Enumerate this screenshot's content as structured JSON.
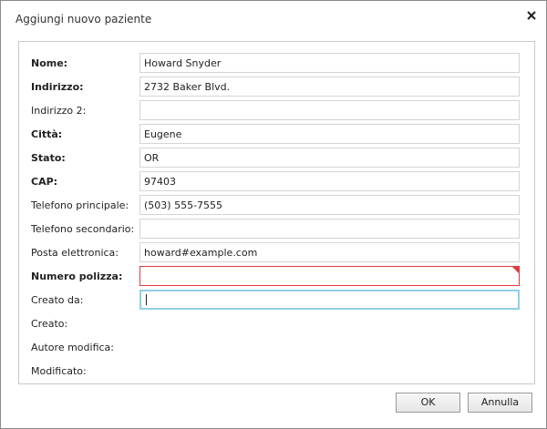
{
  "dialog": {
    "title": "Aggiungi nuovo paziente",
    "close_icon": "close-icon"
  },
  "form": {
    "fields": [
      {
        "label": "Nome:",
        "value": "Howard Snyder",
        "bold": true
      },
      {
        "label": "Indirizzo:",
        "value": "2732 Baker Blvd.",
        "bold": true
      },
      {
        "label": "Indirizzo 2:",
        "value": "",
        "bold": false
      },
      {
        "label": "Città:",
        "value": "Eugene",
        "bold": true
      },
      {
        "label": "Stato:",
        "value": "OR",
        "bold": true
      },
      {
        "label": "CAP:",
        "value": "97403",
        "bold": true
      },
      {
        "label": "Telefono principale:",
        "value": "(503) 555-7555",
        "bold": false
      },
      {
        "label": "Telefono secondario:",
        "value": "",
        "bold": false
      },
      {
        "label": "Posta elettronica:",
        "value": "howard#example.com",
        "bold": false
      },
      {
        "label": "Numero polizza:",
        "value": "",
        "bold": true,
        "state": "error"
      },
      {
        "label": "Creato da:",
        "value": "",
        "bold": false,
        "state": "focused"
      }
    ],
    "readonly": [
      {
        "label": "Creato:"
      },
      {
        "label": "Autore modifica:"
      },
      {
        "label": "Modificato:"
      }
    ]
  },
  "buttons": {
    "ok_label": "OK",
    "cancel_label": "Annulla"
  },
  "colors": {
    "error": "#e03b3b",
    "focus": "#8fd0e6"
  }
}
